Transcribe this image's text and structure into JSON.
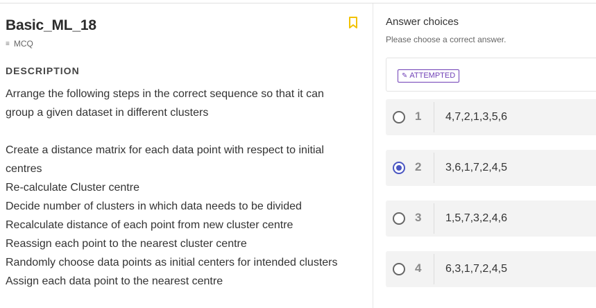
{
  "question": {
    "title": "Basic_ML_18",
    "type": "MCQ",
    "section_label": "DESCRIPTION",
    "description_lines": [
      "Arrange the following steps in the correct  sequence so that it can",
      "group a given dataset in different clusters"
    ],
    "steps_lines": [
      "Create a distance matrix for each data point with respect to initial",
      "centres",
      "Re-calculate Cluster centre",
      "Decide number of clusters in which data needs to be divided",
      "Recalculate distance of each point  from new cluster centre",
      "Reassign each point to the nearest cluster centre",
      "Randomly choose data points as initial centers for intended clusters",
      "Assign each data point to the nearest centre"
    ]
  },
  "answers": {
    "title": "Answer choices",
    "subtitle": "Please choose a correct answer.",
    "status": "ATTEMPTED",
    "options": [
      {
        "num": "1",
        "text": "4,7,2,1,3,5,6",
        "selected": false
      },
      {
        "num": "2",
        "text": "3,6,1,7,2,4,5",
        "selected": true
      },
      {
        "num": "3",
        "text": "1,5,7,3,2,4,6",
        "selected": false
      },
      {
        "num": "4",
        "text": "6,3,1,7,2,4,5",
        "selected": false
      }
    ]
  },
  "colors": {
    "accent": "#4a56c2",
    "status": "#6f3fb6",
    "bookmark": "#f2c200"
  },
  "icons": {
    "bookmark": "bookmark-icon",
    "mcq": "list-icon",
    "pencil": "pencil-icon"
  }
}
